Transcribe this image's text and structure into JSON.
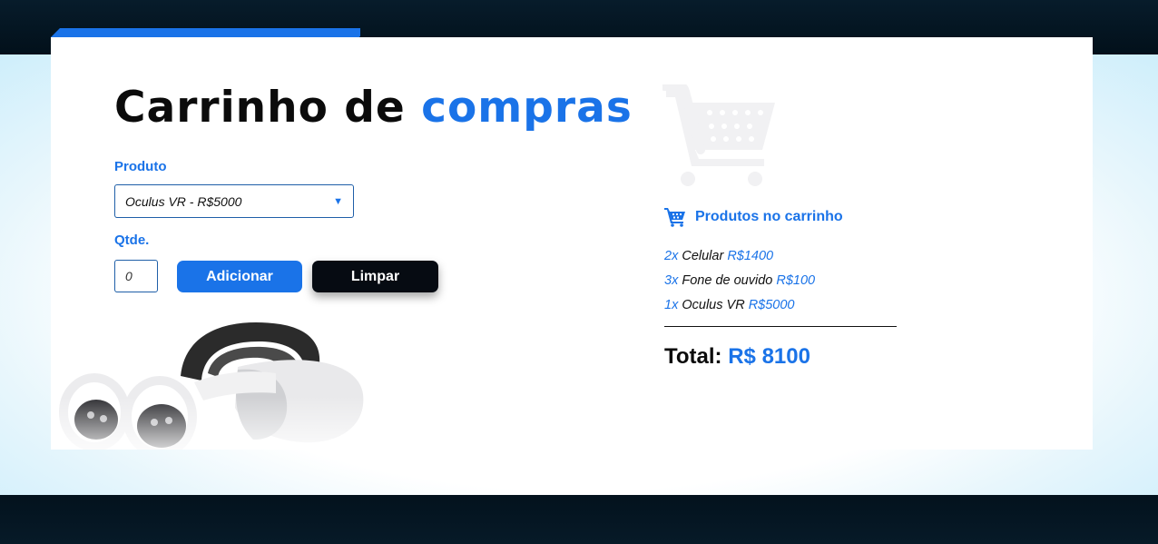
{
  "title": {
    "main": "Carrinho de",
    "accent": "compras"
  },
  "form": {
    "product_label": "Produto",
    "product_selected": "Oculus VR - R$5000",
    "qty_label": "Qtde.",
    "qty_placeholder": "0",
    "add_label": "Adicionar",
    "clear_label": "Limpar"
  },
  "cart": {
    "heading": "Produtos no carrinho",
    "items": [
      {
        "qty": "2x",
        "name": "Celular",
        "price": "R$1400"
      },
      {
        "qty": "3x",
        "name": "Fone de ouvido",
        "price": "R$100"
      },
      {
        "qty": "1x",
        "name": "Oculus VR",
        "price": "R$5000"
      }
    ],
    "total_label": "Total:",
    "total_value": "R$ 8100"
  },
  "icons": {
    "select_caret": "caret-down-icon",
    "cart_heading": "shopping-cart-icon",
    "cart_watermark": "shopping-cart-icon"
  },
  "colors": {
    "accent": "#1a73e8",
    "dark_button": "#060b12",
    "background_dark": "#06141f",
    "cart_watermark": "#f1f1f3"
  }
}
